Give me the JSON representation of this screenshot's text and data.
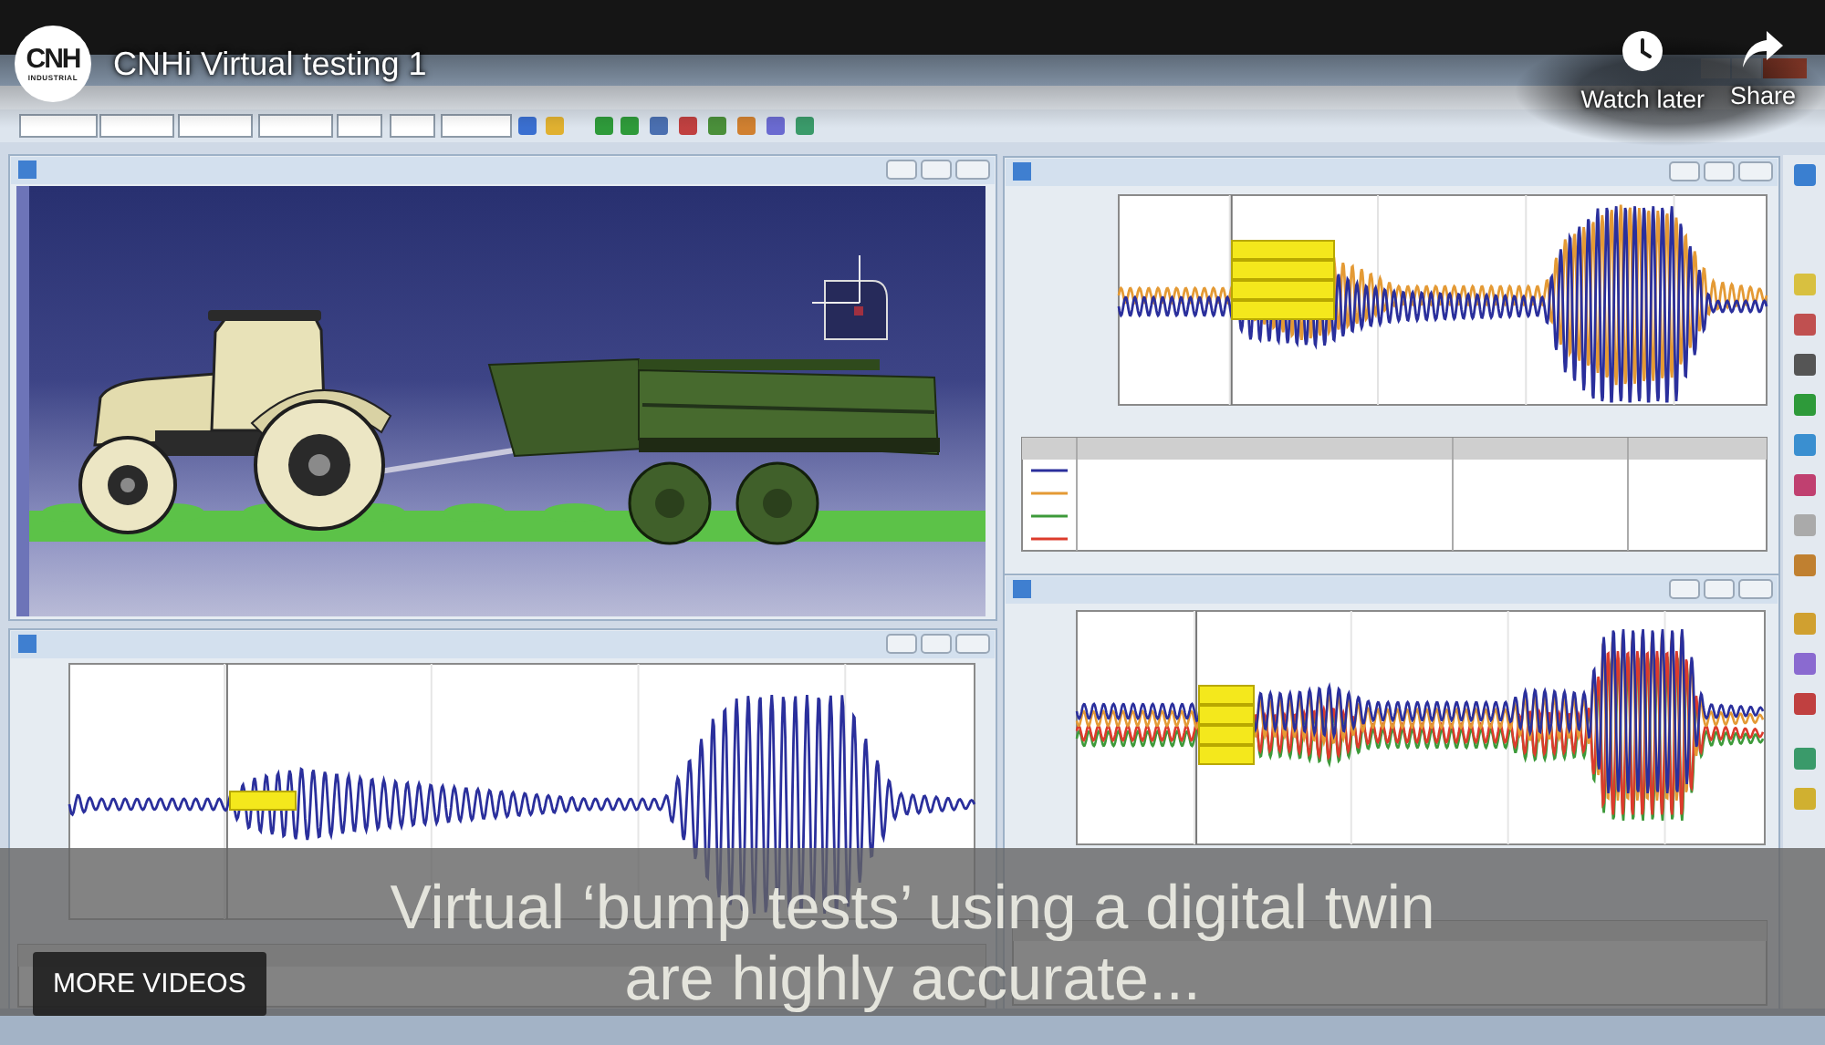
{
  "player": {
    "channel_logo": {
      "mark": "CNH",
      "subtitle": "INDUSTRIAL"
    },
    "title": "CNHi Virtual testing 1",
    "actions": [
      {
        "kind": "watch_later",
        "label": "Watch later"
      },
      {
        "kind": "share",
        "label": "Share"
      }
    ]
  },
  "video": {
    "caption": "Virtual ‘bump tests’ using a digital twin are highly accurate..."
  },
  "more_videos": {
    "label": "MORE VIDEOS"
  }
}
